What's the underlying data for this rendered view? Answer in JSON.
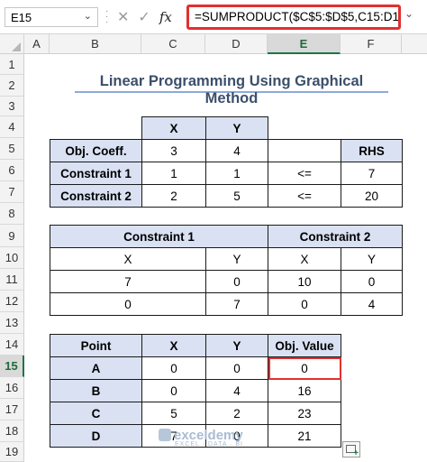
{
  "formula_bar": {
    "name_box": "E15",
    "formula": "=SUMPRODUCT($C$5:$D$5,C15:D15)",
    "cancel_icon": "close-icon",
    "enter_icon": "check-icon",
    "fx_label": "fx"
  },
  "columns": [
    "A",
    "B",
    "C",
    "D",
    "E",
    "F"
  ],
  "rows": [
    "1",
    "2",
    "3",
    "4",
    "5",
    "6",
    "7",
    "8",
    "9",
    "10",
    "11",
    "12",
    "13",
    "14",
    "15",
    "16",
    "17",
    "18",
    "19"
  ],
  "selected_cell": "E15",
  "title": "Linear Programming Using Graphical Method",
  "main_table": {
    "header": [
      "X",
      "Y"
    ],
    "rows": [
      {
        "label": "Obj. Coeff.",
        "x": "3",
        "y": "4",
        "op": "",
        "rhs_header": "RHS"
      },
      {
        "label": "Constraint 1",
        "x": "1",
        "y": "1",
        "op": "<=",
        "rhs": "7"
      },
      {
        "label": "Constraint 2",
        "x": "2",
        "y": "5",
        "op": "<=",
        "rhs": "20"
      }
    ]
  },
  "constraint1": {
    "title": "Constraint 1",
    "header": [
      "X",
      "Y"
    ],
    "rows": [
      [
        "7",
        "0"
      ],
      [
        "0",
        "7"
      ]
    ]
  },
  "constraint2": {
    "title": "Constraint 2",
    "header": [
      "X",
      "Y"
    ],
    "rows": [
      [
        "10",
        "0"
      ],
      [
        "0",
        "4"
      ]
    ]
  },
  "points_table": {
    "header": [
      "Point",
      "X",
      "Y",
      "Obj. Value"
    ],
    "rows": [
      [
        "A",
        "0",
        "0",
        "0"
      ],
      [
        "B",
        "0",
        "4",
        "16"
      ],
      [
        "C",
        "5",
        "2",
        "23"
      ],
      [
        "D",
        "7",
        "0",
        "21"
      ]
    ]
  },
  "watermark": {
    "name": "exceldemy",
    "tagline": "EXCEL · DATA · BI"
  }
}
